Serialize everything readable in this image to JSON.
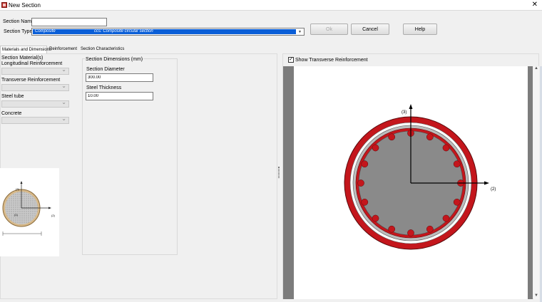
{
  "window": {
    "title": "New Section",
    "close_glyph": "✕"
  },
  "form": {
    "name_label": "Section Name:",
    "name_value": "",
    "type_label": "Section Type:",
    "type_value": "Composite",
    "type_description": "ccs: Composite circular section"
  },
  "buttons": {
    "ok": "Ok",
    "cancel": "Cancel",
    "help": "Help"
  },
  "tabs": [
    "Materials and Dimensions",
    "Reinforcement",
    "Section Characteristics"
  ],
  "materials": {
    "heading": "Section Material(s)",
    "longitudinal_label": "Longitudinal Reinforcement",
    "transverse_label": "Transverse Reinforcement",
    "steel_tube_label": "Steel tube",
    "concrete_label": "Concrete"
  },
  "dimensions": {
    "heading": "Section Dimensions (mm)",
    "diameter_label": "Section Diameter",
    "diameter_value": "300.00",
    "thickness_label": "Steel Thickness",
    "thickness_value": "10.00"
  },
  "preview": {
    "axis_3": "(3)",
    "axis_2": "(2)",
    "bar_label": "(1)"
  },
  "right_panel": {
    "show_transverse_label": "Show Transverse Reinforcement",
    "show_transverse_checked": true,
    "axis_3_label": "(3)",
    "axis_2_label": "(2)"
  },
  "colors": {
    "steel_tube": "#c4161c",
    "concrete": "#8a8a8a",
    "selection": "#0a5ed7",
    "canvas_border": "#7c7c7c"
  },
  "icons": [
    "app-icon",
    "close-icon",
    "check-icon",
    "chevron-down-icon"
  ]
}
